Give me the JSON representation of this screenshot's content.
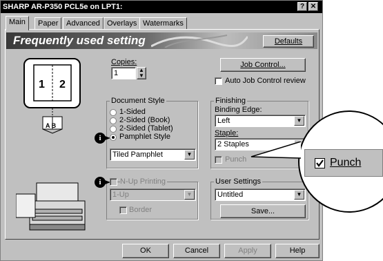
{
  "window": {
    "title": "SHARP AR-P350 PCL5e on LPT1:",
    "help_btn": "?",
    "close_btn": "✕"
  },
  "tabs": [
    "Main",
    "Paper",
    "Advanced",
    "Overlays",
    "Watermarks"
  ],
  "banner": {
    "title": "Frequently used setting",
    "defaults_label": "Defaults"
  },
  "preview": {
    "page_left": "1",
    "page_right": "2",
    "book_label": "A B"
  },
  "copies": {
    "label": "Copies:",
    "value": "1"
  },
  "job_control": {
    "label": "Job Control...",
    "auto_review_label": "Auto Job Control review",
    "auto_review_checked": false
  },
  "document_style": {
    "label": "Document Style",
    "options": [
      "1-Sided",
      "2-Sided (Book)",
      "2-Sided (Tablet)",
      "Pamphlet Style"
    ],
    "selected_index": 3,
    "pamphlet_value": "Tiled Pamphlet"
  },
  "finishing": {
    "label": "Finishing",
    "binding_edge_label": "Binding Edge:",
    "binding_edge_value": "Left",
    "staple_label": "Staple:",
    "staple_value": "2 Staples",
    "punch_label": "Punch",
    "punch_checked": false
  },
  "nup": {
    "label": "N-Up Printing",
    "value": "1-Up",
    "border_label": "Border"
  },
  "user_settings": {
    "label": "User Settings",
    "value": "Untitled",
    "save_label": "Save..."
  },
  "footer": {
    "ok": "OK",
    "cancel": "Cancel",
    "apply": "Apply",
    "help": "Help"
  },
  "callout": {
    "punch_label": "Punch",
    "punch_checked": true
  },
  "icons": {
    "info": "info-icon",
    "printer": "printer-icon",
    "booklet": "booklet-icon"
  }
}
